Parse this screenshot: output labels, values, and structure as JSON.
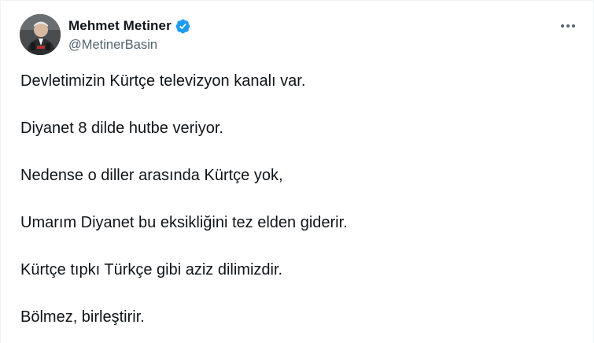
{
  "author": {
    "display_name": "Mehmet Metiner",
    "handle": "@MetinerBasin",
    "verified": true,
    "avatar_icon": "person-portrait-avatar"
  },
  "actions": {
    "more_icon": "more-horizontal-icon"
  },
  "tweet": {
    "lines": [
      "Devletimizin Kürtçe televizyon kanalı var.",
      "Diyanet 8 dilde hutbe veriyor.",
      "Nedense o diller arasında Kürtçe yok,",
      "Umarım Diyanet bu eksikliğini tez elden giderir.",
      "Kürtçe tıpkı Türkçe gibi aziz dilimizdir.",
      "Bölmez, birleştirir."
    ]
  },
  "colors": {
    "text_primary": "#0f1419",
    "text_secondary": "#536471",
    "verified_blue": "#1d9bf0",
    "border": "#eff3f4"
  }
}
